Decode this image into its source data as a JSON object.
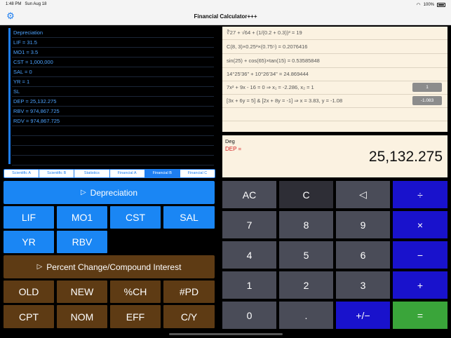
{
  "status": {
    "time": "1:48 PM",
    "date": "Sun Aug 18",
    "battery": "100%"
  },
  "app": {
    "title": "Financial Calculator+++"
  },
  "tape": [
    "Depreciation",
    "LIF = 31.5",
    "MO1 = 3.5",
    "CST = 1,000,000",
    "SAL = 0",
    "YR = 1",
    "SL",
    "DEP = 25,132.275",
    "RBV = 974,867.725",
    "RDV = 974,867.725",
    "",
    "",
    "",
    ""
  ],
  "tabs": [
    {
      "label": "Scientific A",
      "active": false
    },
    {
      "label": "Scientific B",
      "active": false
    },
    {
      "label": "Statistics",
      "active": false
    },
    {
      "label": "Financial A",
      "active": false
    },
    {
      "label": "Financial B",
      "active": true
    },
    {
      "label": "Financial C",
      "active": false
    }
  ],
  "depreciation": {
    "label": "Depreciation",
    "keys": [
      "LIF",
      "MO1",
      "CST",
      "SAL",
      "YR",
      "RBV"
    ]
  },
  "percent": {
    "label": "Percent Change/Compound Interest",
    "keys": [
      "OLD",
      "NEW",
      "%CH",
      "#PD",
      "CPT",
      "NOM",
      "EFF",
      "C/Y"
    ]
  },
  "history": [
    {
      "expr": "∛27 + √64 + (1/(0.2 + 0.3))³ = 19",
      "button": ""
    },
    {
      "expr": "C(8, 3)×0.25³×(0.75⁵) = 0.2076416",
      "button": ""
    },
    {
      "expr": "sin(25) + cos(65)×tan(15) = 0.53585848",
      "button": ""
    },
    {
      "expr": "14°25'36\" + 10°26'34\" = 24.869444",
      "button": ""
    },
    {
      "expr": "7x² + 9x - 16 = 0     ⇒     x₁ = -2.286, x₂ = 1",
      "button": "1"
    },
    {
      "expr": "[3x + 6y = 5]  &  [2x + 8y = -1] ⇒ x = 3.83, y = -1.08",
      "button": "-1.083"
    },
    {
      "expr": "",
      "button": ""
    }
  ],
  "display": {
    "mode": "Deg",
    "label": "DEP =",
    "value": "25,132.275"
  },
  "keypad": {
    "row1": [
      "AC",
      "C",
      "◁",
      "÷"
    ],
    "row2": [
      "7",
      "8",
      "9",
      "×"
    ],
    "row3": [
      "4",
      "5",
      "6",
      "−"
    ],
    "row4": [
      "1",
      "2",
      "3",
      "+"
    ],
    "row5": [
      "0",
      ".",
      "+/−",
      "="
    ]
  },
  "icons": {
    "settings": "gear-icon",
    "play": "play-icon",
    "backspace": "backspace-icon"
  },
  "colors": {
    "accent": "#1e7ef0",
    "brown": "#5e3b14",
    "operator": "#1912cc",
    "equals": "#3aa53a",
    "display_bg": "#fbf2e1"
  }
}
